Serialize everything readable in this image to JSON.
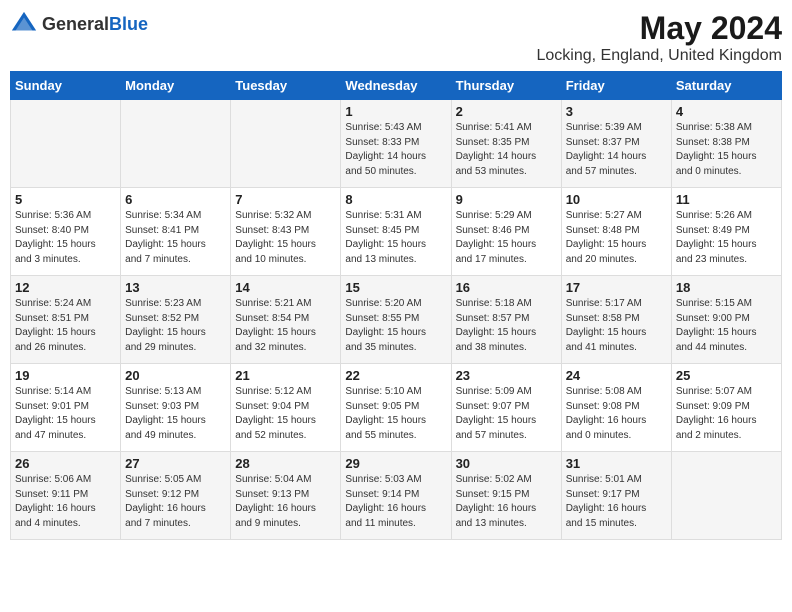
{
  "header": {
    "logo_general": "General",
    "logo_blue": "Blue",
    "title": "May 2024",
    "subtitle": "Locking, England, United Kingdom"
  },
  "days_of_week": [
    "Sunday",
    "Monday",
    "Tuesday",
    "Wednesday",
    "Thursday",
    "Friday",
    "Saturday"
  ],
  "weeks": [
    [
      {
        "day": "",
        "content": ""
      },
      {
        "day": "",
        "content": ""
      },
      {
        "day": "",
        "content": ""
      },
      {
        "day": "1",
        "content": "Sunrise: 5:43 AM\nSunset: 8:33 PM\nDaylight: 14 hours\nand 50 minutes."
      },
      {
        "day": "2",
        "content": "Sunrise: 5:41 AM\nSunset: 8:35 PM\nDaylight: 14 hours\nand 53 minutes."
      },
      {
        "day": "3",
        "content": "Sunrise: 5:39 AM\nSunset: 8:37 PM\nDaylight: 14 hours\nand 57 minutes."
      },
      {
        "day": "4",
        "content": "Sunrise: 5:38 AM\nSunset: 8:38 PM\nDaylight: 15 hours\nand 0 minutes."
      }
    ],
    [
      {
        "day": "5",
        "content": "Sunrise: 5:36 AM\nSunset: 8:40 PM\nDaylight: 15 hours\nand 3 minutes."
      },
      {
        "day": "6",
        "content": "Sunrise: 5:34 AM\nSunset: 8:41 PM\nDaylight: 15 hours\nand 7 minutes."
      },
      {
        "day": "7",
        "content": "Sunrise: 5:32 AM\nSunset: 8:43 PM\nDaylight: 15 hours\nand 10 minutes."
      },
      {
        "day": "8",
        "content": "Sunrise: 5:31 AM\nSunset: 8:45 PM\nDaylight: 15 hours\nand 13 minutes."
      },
      {
        "day": "9",
        "content": "Sunrise: 5:29 AM\nSunset: 8:46 PM\nDaylight: 15 hours\nand 17 minutes."
      },
      {
        "day": "10",
        "content": "Sunrise: 5:27 AM\nSunset: 8:48 PM\nDaylight: 15 hours\nand 20 minutes."
      },
      {
        "day": "11",
        "content": "Sunrise: 5:26 AM\nSunset: 8:49 PM\nDaylight: 15 hours\nand 23 minutes."
      }
    ],
    [
      {
        "day": "12",
        "content": "Sunrise: 5:24 AM\nSunset: 8:51 PM\nDaylight: 15 hours\nand 26 minutes."
      },
      {
        "day": "13",
        "content": "Sunrise: 5:23 AM\nSunset: 8:52 PM\nDaylight: 15 hours\nand 29 minutes."
      },
      {
        "day": "14",
        "content": "Sunrise: 5:21 AM\nSunset: 8:54 PM\nDaylight: 15 hours\nand 32 minutes."
      },
      {
        "day": "15",
        "content": "Sunrise: 5:20 AM\nSunset: 8:55 PM\nDaylight: 15 hours\nand 35 minutes."
      },
      {
        "day": "16",
        "content": "Sunrise: 5:18 AM\nSunset: 8:57 PM\nDaylight: 15 hours\nand 38 minutes."
      },
      {
        "day": "17",
        "content": "Sunrise: 5:17 AM\nSunset: 8:58 PM\nDaylight: 15 hours\nand 41 minutes."
      },
      {
        "day": "18",
        "content": "Sunrise: 5:15 AM\nSunset: 9:00 PM\nDaylight: 15 hours\nand 44 minutes."
      }
    ],
    [
      {
        "day": "19",
        "content": "Sunrise: 5:14 AM\nSunset: 9:01 PM\nDaylight: 15 hours\nand 47 minutes."
      },
      {
        "day": "20",
        "content": "Sunrise: 5:13 AM\nSunset: 9:03 PM\nDaylight: 15 hours\nand 49 minutes."
      },
      {
        "day": "21",
        "content": "Sunrise: 5:12 AM\nSunset: 9:04 PM\nDaylight: 15 hours\nand 52 minutes."
      },
      {
        "day": "22",
        "content": "Sunrise: 5:10 AM\nSunset: 9:05 PM\nDaylight: 15 hours\nand 55 minutes."
      },
      {
        "day": "23",
        "content": "Sunrise: 5:09 AM\nSunset: 9:07 PM\nDaylight: 15 hours\nand 57 minutes."
      },
      {
        "day": "24",
        "content": "Sunrise: 5:08 AM\nSunset: 9:08 PM\nDaylight: 16 hours\nand 0 minutes."
      },
      {
        "day": "25",
        "content": "Sunrise: 5:07 AM\nSunset: 9:09 PM\nDaylight: 16 hours\nand 2 minutes."
      }
    ],
    [
      {
        "day": "26",
        "content": "Sunrise: 5:06 AM\nSunset: 9:11 PM\nDaylight: 16 hours\nand 4 minutes."
      },
      {
        "day": "27",
        "content": "Sunrise: 5:05 AM\nSunset: 9:12 PM\nDaylight: 16 hours\nand 7 minutes."
      },
      {
        "day": "28",
        "content": "Sunrise: 5:04 AM\nSunset: 9:13 PM\nDaylight: 16 hours\nand 9 minutes."
      },
      {
        "day": "29",
        "content": "Sunrise: 5:03 AM\nSunset: 9:14 PM\nDaylight: 16 hours\nand 11 minutes."
      },
      {
        "day": "30",
        "content": "Sunrise: 5:02 AM\nSunset: 9:15 PM\nDaylight: 16 hours\nand 13 minutes."
      },
      {
        "day": "31",
        "content": "Sunrise: 5:01 AM\nSunset: 9:17 PM\nDaylight: 16 hours\nand 15 minutes."
      },
      {
        "day": "",
        "content": ""
      }
    ]
  ]
}
